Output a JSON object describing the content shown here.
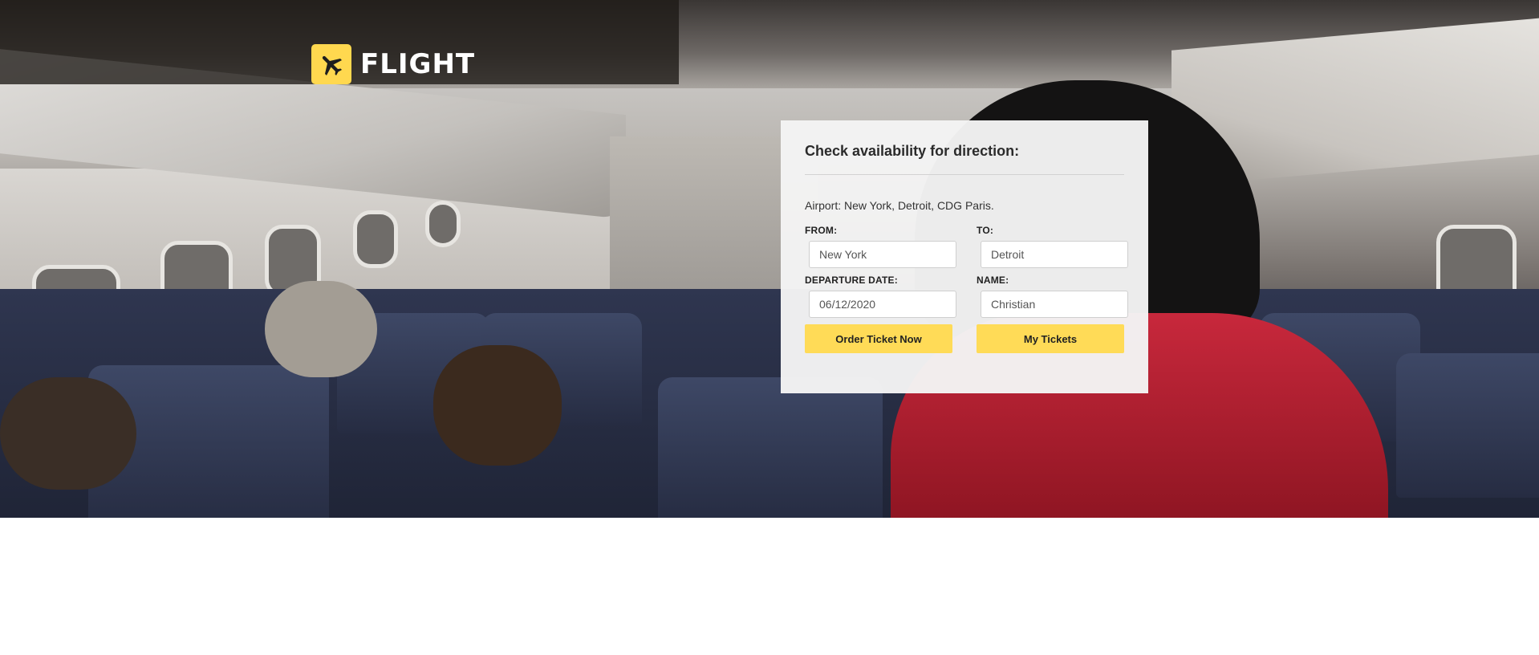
{
  "brand": {
    "name": "FLIGHT",
    "icon": "airplane-icon",
    "accent_color": "#ffd84f"
  },
  "booking": {
    "title": "Check availability for direction:",
    "airports_text": "Airport: New York, Detroit, CDG Paris.",
    "fields": {
      "from": {
        "label": "FROM:",
        "value": "New York"
      },
      "to": {
        "label": "TO:",
        "value": "Detroit"
      },
      "departure_date": {
        "label": "DEPARTURE DATE:",
        "value": "06/12/2020"
      },
      "name": {
        "label": "NAME:",
        "value": "Christian"
      }
    },
    "buttons": {
      "order": "Order Ticket Now",
      "my_tickets": "My Tickets"
    },
    "button_color": "#ffdb57"
  }
}
